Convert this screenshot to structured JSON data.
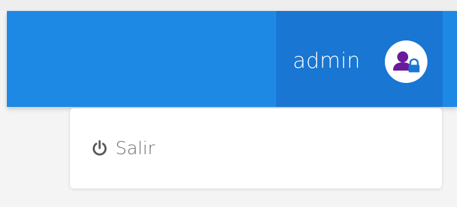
{
  "header": {
    "username": "admin",
    "avatar_icon": "user-lock-icon",
    "colors": {
      "navbar": "#1e88e5",
      "user_area": "#1976d2",
      "avatar_person": "#6a1b9a",
      "avatar_lock": "#1976d2"
    }
  },
  "user_menu": {
    "items": [
      {
        "label": "Salir",
        "icon": "power-icon"
      }
    ]
  }
}
